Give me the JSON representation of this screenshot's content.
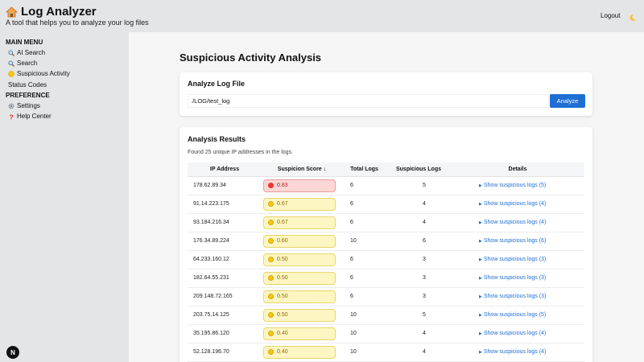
{
  "header": {
    "title": "Log Analyzer",
    "subtitle": "A tool that helps you to analyze your log files",
    "logout_label": "Logout"
  },
  "sidebar": {
    "main_menu_heading": "MAIN MENU",
    "items": [
      {
        "label": "AI Search",
        "icon": "magnifier-icon"
      },
      {
        "label": "Search",
        "icon": "magnifier-icon"
      },
      {
        "label": "Suspicious Activity",
        "icon": "yellow-circle-icon"
      },
      {
        "label": "Status Codes",
        "icon": ""
      }
    ],
    "preference_heading": "PREFERENCE",
    "pref_items": [
      {
        "label": "Settings",
        "icon": "gear-icon"
      },
      {
        "label": "Help Center",
        "icon": "question-icon"
      }
    ],
    "badge": "N"
  },
  "main": {
    "page_title": "Suspicious Activity Analysis",
    "analyze_card": {
      "title": "Analyze Log File",
      "path_value": "./LOG/test_log",
      "button_label": "Analyze"
    },
    "results_card": {
      "title": "Analysis Results",
      "summary": "Found 25 unique IP addresses in the logs.",
      "columns": [
        "IP Address",
        "Suspicion Score ↓",
        "Total Logs",
        "Suspicious Logs",
        "Details"
      ],
      "rows": [
        {
          "ip": "178.62.89.34",
          "score": "0.83",
          "level": "high",
          "total": "6",
          "suspicious": "5",
          "details": "Show suspicious logs (5)"
        },
        {
          "ip": "91.14.223.175",
          "score": "0.67",
          "level": "med",
          "total": "6",
          "suspicious": "4",
          "details": "Show suspicious logs (4)"
        },
        {
          "ip": "93.184.216.34",
          "score": "0.67",
          "level": "med",
          "total": "6",
          "suspicious": "4",
          "details": "Show suspicious logs (4)"
        },
        {
          "ip": "176.34.89.224",
          "score": "0.60",
          "level": "med",
          "total": "10",
          "suspicious": "6",
          "details": "Show suspicious logs (6)"
        },
        {
          "ip": "64.233.160.12",
          "score": "0.50",
          "level": "med",
          "total": "6",
          "suspicious": "3",
          "details": "Show suspicious logs (3)"
        },
        {
          "ip": "182.64.55.231",
          "score": "0.50",
          "level": "med",
          "total": "6",
          "suspicious": "3",
          "details": "Show suspicious logs (3)"
        },
        {
          "ip": "209.148.72.165",
          "score": "0.50",
          "level": "med",
          "total": "6",
          "suspicious": "3",
          "details": "Show suspicious logs (3)"
        },
        {
          "ip": "203.75.14.125",
          "score": "0.50",
          "level": "med",
          "total": "10",
          "suspicious": "5",
          "details": "Show suspicious logs (5)"
        },
        {
          "ip": "35.195.86.120",
          "score": "0.40",
          "level": "med",
          "total": "10",
          "suspicious": "4",
          "details": "Show suspicious logs (4)"
        },
        {
          "ip": "52.128.196.70",
          "score": "0.40",
          "level": "med",
          "total": "10",
          "suspicious": "4",
          "details": "Show suspicious logs (4)"
        }
      ]
    }
  },
  "colors": {
    "accent": "#1f6ed4",
    "high_score_bg": "#fdd6d6",
    "medium_score_bg": "#fdf6c3"
  }
}
